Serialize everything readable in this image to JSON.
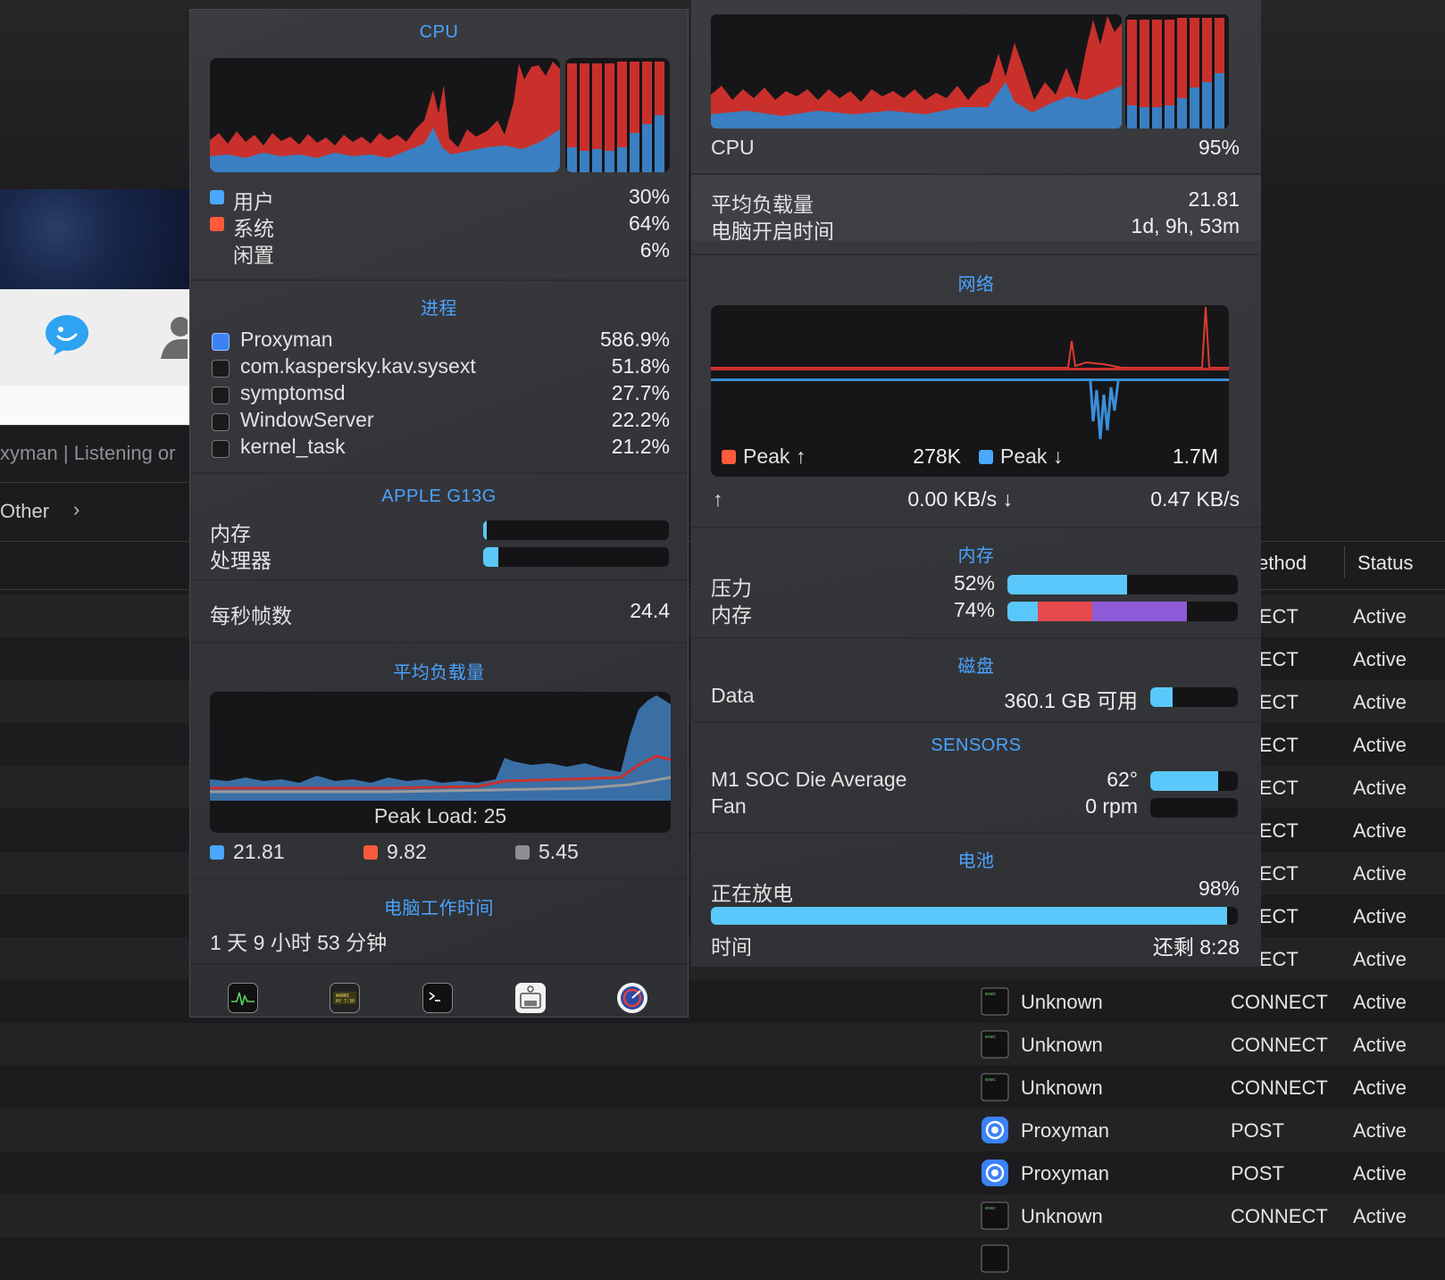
{
  "background_app": {
    "status_text": "xyman | Listening or",
    "filter_label": "Other",
    "table": {
      "method_header": "ethod",
      "status_header": "Status",
      "rows_partial": [
        {
          "method": "NNECT",
          "status": "Active"
        },
        {
          "method": "NNECT",
          "status": "Active"
        },
        {
          "method": "NNECT",
          "status": "Active"
        },
        {
          "method": "NNECT",
          "status": "Active"
        },
        {
          "method": "NNECT",
          "status": "Active"
        },
        {
          "method": "NNECT",
          "status": "Active"
        },
        {
          "method": "NNECT",
          "status": "Active"
        },
        {
          "method": "NNECT",
          "status": "Active"
        },
        {
          "method": "NNECT",
          "status": "Active"
        }
      ],
      "rows_full": [
        {
          "client": "Unknown",
          "icon": "exec-icon",
          "method": "CONNECT",
          "status": "Active"
        },
        {
          "client": "Unknown",
          "icon": "exec-icon",
          "method": "CONNECT",
          "status": "Active"
        },
        {
          "client": "Unknown",
          "icon": "exec-icon",
          "method": "CONNECT",
          "status": "Active"
        },
        {
          "client": "Proxyman",
          "icon": "proxyman-icon",
          "method": "POST",
          "status": "Active"
        },
        {
          "client": "Proxyman",
          "icon": "proxyman-icon",
          "method": "POST",
          "status": "Active"
        },
        {
          "client": "Unknown",
          "icon": "exec-icon",
          "method": "CONNECT",
          "status": "Active"
        }
      ]
    }
  },
  "left_panel": {
    "cpu": {
      "title": "CPU",
      "legend": [
        {
          "label": "用户",
          "value": "30%",
          "color": "#4aa8ff"
        },
        {
          "label": "系统",
          "value": "64%",
          "color": "#ff5a3c"
        },
        {
          "label": "闲置",
          "value": "6%",
          "color": ""
        }
      ]
    },
    "processes": {
      "title": "进程",
      "items": [
        {
          "name": "Proxyman",
          "value": "586.9%",
          "icon": "proxyman-icon"
        },
        {
          "name": "com.kaspersky.kav.sysext",
          "value": "51.8%",
          "icon": "exec-icon"
        },
        {
          "name": "symptomsd",
          "value": "27.7%",
          "icon": "exec-icon"
        },
        {
          "name": "WindowServer",
          "value": "22.2%",
          "icon": "exec-icon"
        },
        {
          "name": "kernel_task",
          "value": "21.2%",
          "icon": "exec-icon"
        }
      ]
    },
    "gpu": {
      "title": "APPLE G13G",
      "memory_label": "内存",
      "memory_fraction": 0.02,
      "processor_label": "处理器",
      "processor_fraction": 0.08
    },
    "fps": {
      "label": "每秒帧数",
      "value": "24.4"
    },
    "load": {
      "title": "平均负载量",
      "peak_label": "Peak Load: 25",
      "legend": [
        {
          "value": "21.81",
          "color": "#4aa8ff"
        },
        {
          "value": "9.82",
          "color": "#ff5a3c"
        },
        {
          "value": "5.45",
          "color": "#8e8e93"
        }
      ]
    },
    "uptime": {
      "title": "电脑工作时间",
      "value": "1 天 9 小时 53 分钟"
    },
    "dock": [
      "activity-monitor-icon",
      "console-icon",
      "terminal-icon",
      "system-info-icon",
      "disk-utility-icon"
    ]
  },
  "right_panel": {
    "cpu": {
      "label": "CPU",
      "value": "95%"
    },
    "load": {
      "label": "平均负载量",
      "value": "21.81",
      "uptime_label": "电脑开启时间",
      "uptime_value": "1d, 9h, 53m"
    },
    "network": {
      "title": "网络",
      "peak_up_label": "Peak ↑",
      "peak_up_value": "278K",
      "peak_down_label": "Peak ↓",
      "peak_down_value": "1.7M",
      "up_arrow": "↑",
      "up_rate": "0.00 KB/s ↓",
      "down_rate": "0.47 KB/s"
    },
    "memory": {
      "title": "内存",
      "pressure_label": "压力",
      "pressure_value": "52%",
      "pressure_fraction": 0.52,
      "memory_label": "内存",
      "memory_value": "74%",
      "memory_segments": [
        0.13,
        0.24,
        0.41
      ]
    },
    "disk": {
      "title": "磁盘",
      "name": "Data",
      "free": "360.1 GB 可用",
      "used_fraction": 0.25
    },
    "sensors": {
      "title": "SENSORS",
      "soc_label": "M1 SOC Die Average",
      "soc_value": "62°",
      "soc_fraction": 0.78,
      "fan_label": "Fan",
      "fan_value": "0 rpm",
      "fan_fraction": 0
    },
    "battery": {
      "title": "电池",
      "state_label": "正在放电",
      "percent": "98%",
      "fraction": 0.98,
      "time_label": "时间",
      "time_value": "还剩 8:28"
    }
  }
}
